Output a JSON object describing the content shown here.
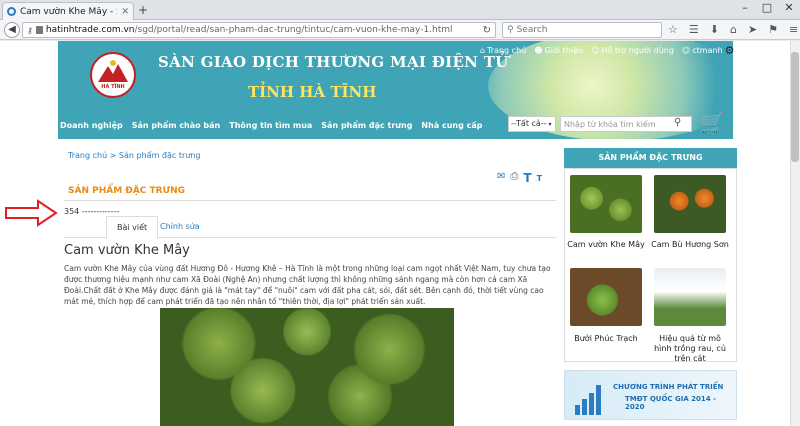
{
  "browser": {
    "tab_title": "Cam vườn Khe Mây - Sàn ...",
    "new_tab": "+",
    "url_domain": "hatinhtrade.com.vn",
    "url_path": "/sgd/portal/read/san-pham-dac-trung/tintuc/cam-vuon-khe-may-1.html",
    "search_placeholder": "Search",
    "window_controls": [
      "–",
      "□",
      "✕"
    ]
  },
  "site": {
    "title": "SÀN GIAO DỊCH THƯƠNG MẠI ĐIỆN TỬ",
    "subtitle": "TỈNH HÀ TĨNH",
    "logo_text": "HÀ TĨNH",
    "top_links": [
      "Trang chủ",
      "Giới thiệu",
      "Hỗ trợ người dùng",
      "ctmanh"
    ],
    "menu": [
      "Doanh nghiệp",
      "Sản phẩm chào bán",
      "Thông tin tìm mua",
      "Sản phẩm đặc trưng",
      "Nhà cung cấp"
    ],
    "search_category": "--Tất cả--",
    "search_placeholder": "Nhập từ khóa tìm kiếm"
  },
  "content": {
    "breadcrumb": "Trang chủ > Sản phẩm đặc trưng",
    "section_title": "SẢN PHẨM ĐẶC TRƯNG",
    "views": "354 -------------",
    "tabs": [
      "Bài viết",
      "Chỉnh sửa"
    ],
    "article_title": "Cam vườn Khe Mây",
    "article_body": "Cam vườn Khe Mây của vùng đất Hương Đô - Hương Khê – Hà Tĩnh là một trong những loại cam ngọt nhất Việt Nam, tuy chưa tạo được thương hiệu mạnh như cam Xã Đoài (Nghệ An) nhưng chất lượng thì không những sánh ngang mà còn hơn cả cam Xã Đoài.Chất đất ở Khe Mây được đánh giá là \"mát tay\" để \"nuôi\" cam với đất pha cát, sỏi, đất sét. Bên cạnh đó, thời tiết vùng cao mát mẻ, thích hợp để cam phát triển đã tạo nên nhân tố \"thiên thời, địa lợi\" phát triển sản xuất."
  },
  "sidebar": {
    "heading": "SẢN PHẨM ĐẶC TRƯNG",
    "products": [
      "Cam vườn Khe Mây",
      "Cam Bù Hương Sơn",
      "Bưởi Phúc Trạch",
      "Hiệu quả từ mô hình trồng rau, củ trên cát"
    ],
    "banner_line1": "CHƯƠNG TRÌNH PHÁT TRIỂN",
    "banner_line2": "TMĐT QUỐC GIA 2014 - 2020"
  },
  "colors": {
    "header": "#3fa4b5",
    "accent": "#e98c16",
    "link": "#2a7bbf",
    "arrow": "#e02020"
  }
}
